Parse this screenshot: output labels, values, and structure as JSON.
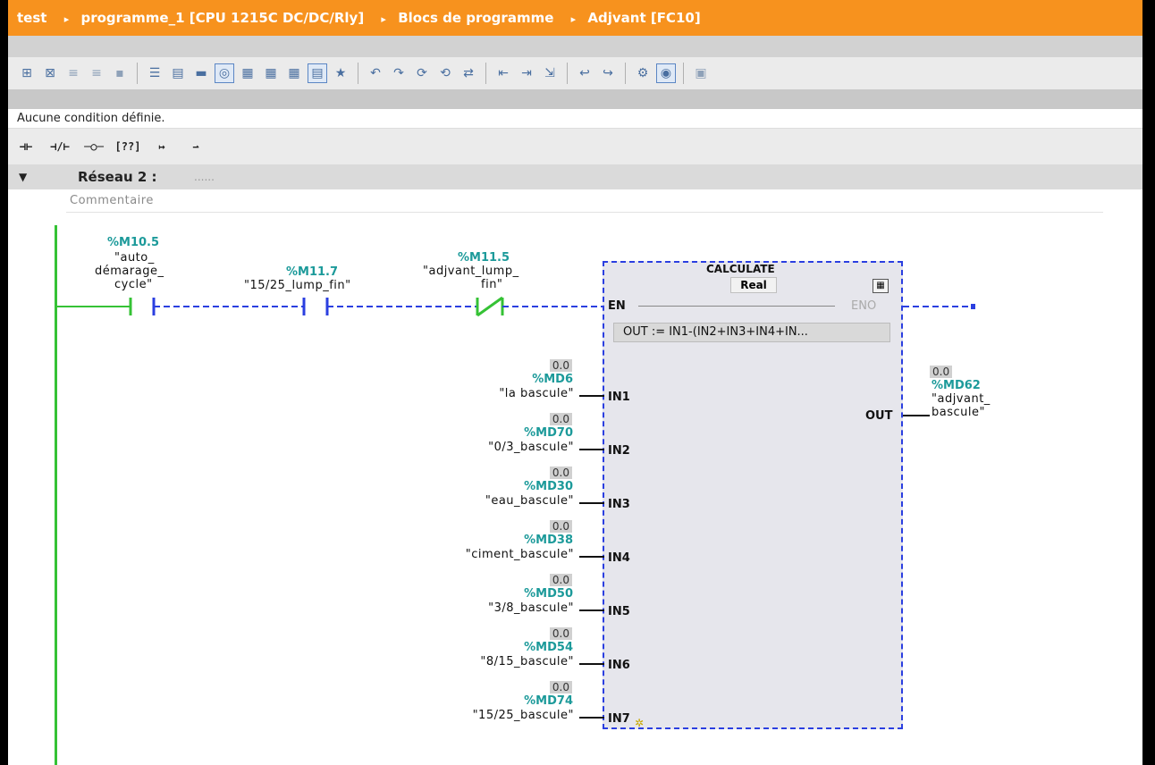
{
  "title_bar": {
    "crumbs": [
      "test",
      "programme_1 [CPU 1215C DC/DC/Rly]",
      "Blocs de programme",
      "Adjvant [FC10]"
    ],
    "separator": "▸"
  },
  "condition_text": "Aucune condition définie.",
  "network": {
    "label": "Réseau 2 :",
    "title_placeholder": "......",
    "comment": "Commentaire"
  },
  "contacts": [
    {
      "address": "%M10.5",
      "name_lines": [
        "\"auto_",
        "démarage_",
        "cycle\""
      ]
    },
    {
      "address": "%M11.7",
      "name_lines": [
        "\"15/25_lump_fin\""
      ]
    },
    {
      "address": "%M11.5",
      "name_lines": [
        "\"adjvant_lump_",
        "fin\""
      ]
    }
  ],
  "block": {
    "name": "CALCULATE",
    "type": "Real",
    "en": "EN",
    "eno": "ENO",
    "formula": "OUT :=   IN1-(IN2+IN3+IN4+IN...",
    "inputs": [
      {
        "pin": "IN1",
        "value": "0.0",
        "address": "%MD6",
        "name": "\"la bascule\""
      },
      {
        "pin": "IN2",
        "value": "0.0",
        "address": "%MD70",
        "name": "\"0/3_bascule\""
      },
      {
        "pin": "IN3",
        "value": "0.0",
        "address": "%MD30",
        "name": "\"eau_bascule\""
      },
      {
        "pin": "IN4",
        "value": "0.0",
        "address": "%MD38",
        "name": "\"ciment_bascule\""
      },
      {
        "pin": "IN5",
        "value": "0.0",
        "address": "%MD50",
        "name": "\"3/8_bascule\""
      },
      {
        "pin": "IN6",
        "value": "0.0",
        "address": "%MD54",
        "name": "\"8/15_bascule\""
      },
      {
        "pin": "IN7",
        "value": "0.0",
        "address": "%MD74",
        "name": "\"15/25_bascule\""
      }
    ],
    "output": {
      "pin": "OUT",
      "value": "0.0",
      "address": "%MD62",
      "name_lines": [
        "\"adjvant_",
        "bascule\""
      ]
    }
  },
  "colors": {
    "title_bar": "#f7921e",
    "power_rail": "#35c235",
    "dashed_wire": "#2b3fe0",
    "address": "#1c9a9a"
  }
}
